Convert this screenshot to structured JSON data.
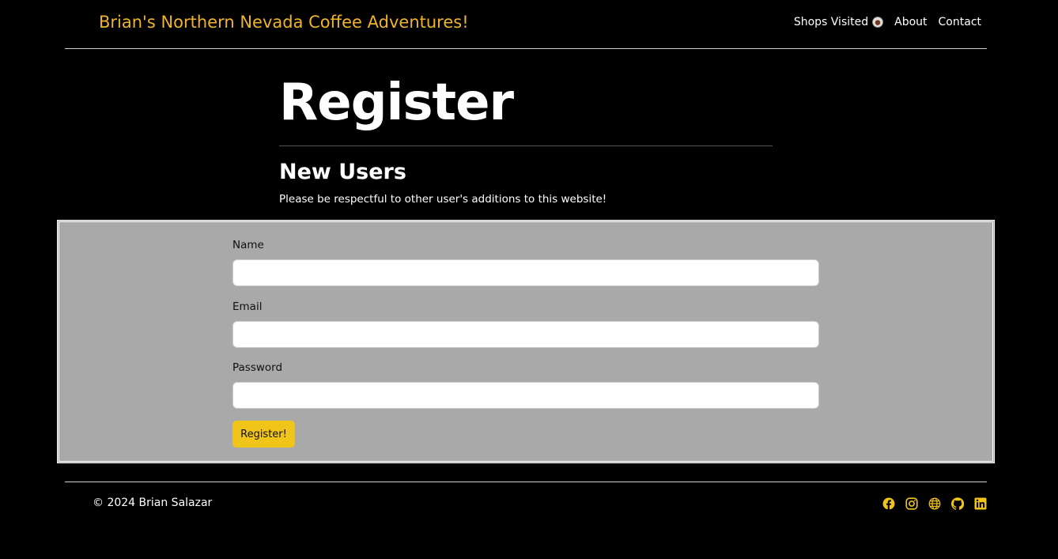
{
  "nav": {
    "brand": "Brian's Northern Nevada Coffee Adventures!",
    "links": [
      {
        "label": "Shops Visited",
        "icon": "coffee-cup-icon"
      },
      {
        "label": "About"
      },
      {
        "label": "Contact"
      }
    ]
  },
  "main": {
    "title": "Register",
    "subtitle": "New Users",
    "intro": "Please be respectful to other user's additions to this website!",
    "form": {
      "fields": [
        {
          "label": "Name",
          "value": ""
        },
        {
          "label": "Email",
          "value": ""
        },
        {
          "label": "Password",
          "value": ""
        }
      ],
      "submit_label": "Register!"
    }
  },
  "footer": {
    "copyright": "© 2024 Brian Salazar",
    "social_icons": [
      "facebook-icon",
      "instagram-icon",
      "globe-icon",
      "github-icon",
      "linkedin-icon"
    ]
  },
  "colors": {
    "background": "#000000",
    "accent": "#f0b429",
    "button": "#f0c419",
    "panel": "#a9a9a9"
  }
}
